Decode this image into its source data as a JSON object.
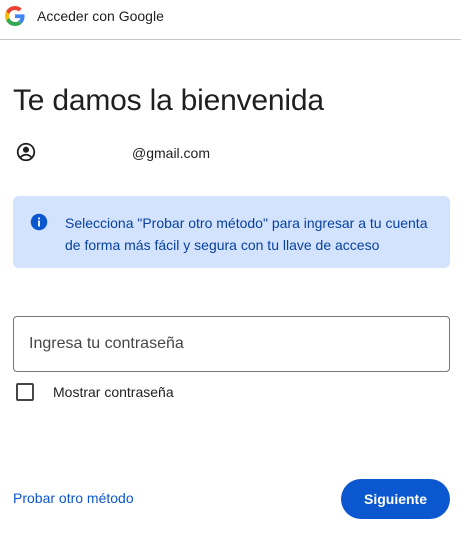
{
  "header": {
    "logo_icon": "google-g-logo",
    "title": "Acceder con Google"
  },
  "main": {
    "title": "Te damos la bienvenida",
    "account": {
      "icon": "account-circle-icon",
      "email": "@gmail.com"
    },
    "info_banner": {
      "icon": "info-icon",
      "text": "Selecciona \"Probar otro método\" para ingresar a tu cuenta de forma más fácil y segura con tu llave de acceso",
      "background_color": "#d3e3fd",
      "text_color": "#0842a0"
    },
    "password_field": {
      "placeholder": "Ingresa tu contraseña",
      "value": ""
    },
    "show_password": {
      "label": "Mostrar contraseña",
      "checked": false
    },
    "actions": {
      "try_another_label": "Probar otro método",
      "next_label": "Siguiente",
      "accent_color": "#0b57d0"
    }
  }
}
